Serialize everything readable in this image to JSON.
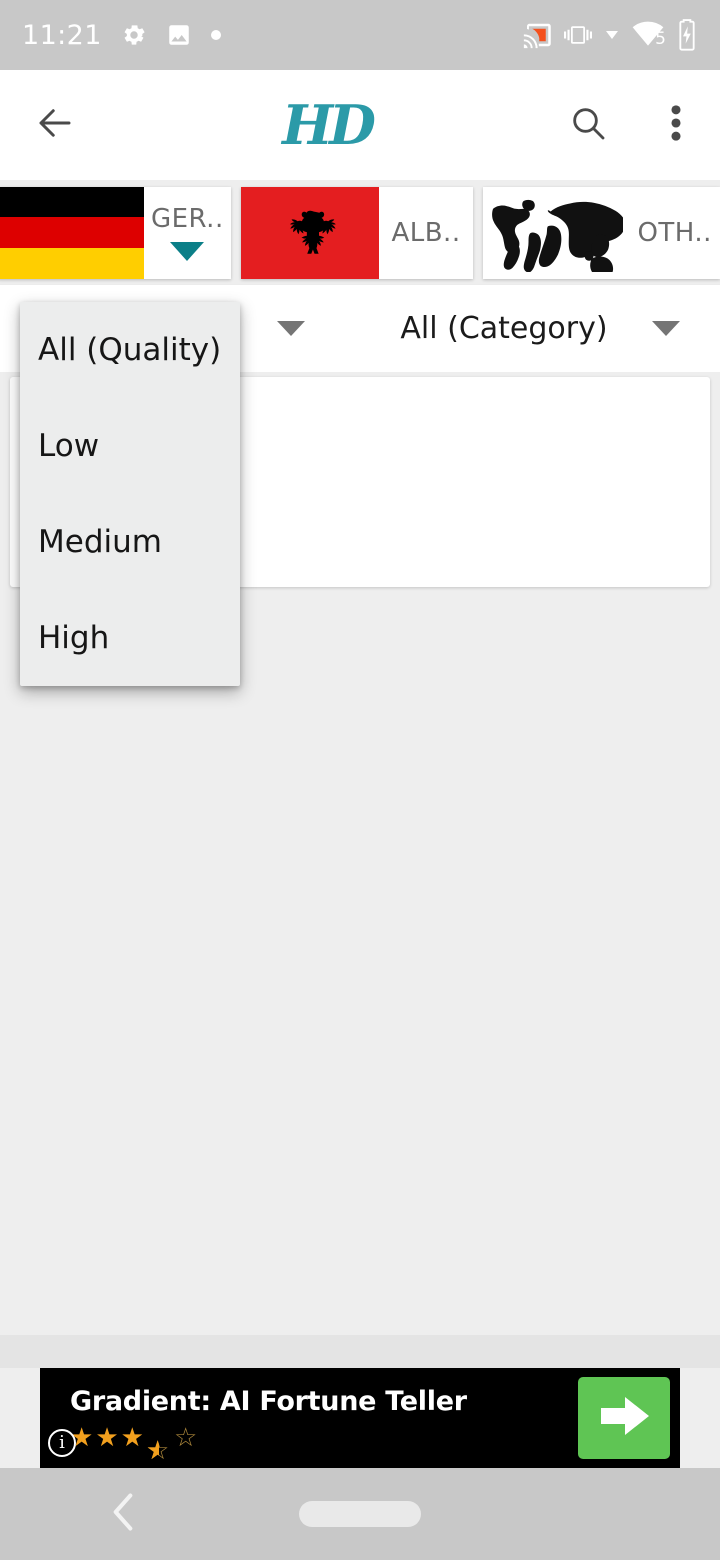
{
  "status_bar": {
    "time": "11:21",
    "left_icons": [
      "settings-gear-icon",
      "image-icon",
      "dot-icon"
    ],
    "right_icons": [
      "cast-icon",
      "vibrate-icon",
      "dropdown-arrow-icon",
      "wifi-icon",
      "battery-charging-icon"
    ],
    "wifi_badge": "5",
    "background": "#c8c8c8",
    "cast_color": "#f4511e"
  },
  "app_bar": {
    "back_icon": "back-arrow-icon",
    "logo_text": "HD",
    "logo_color": "#2b9aa8",
    "search_icon": "search-icon",
    "overflow_icon": "more-vertical-icon",
    "background": "#ffffff"
  },
  "country_tabs": [
    {
      "label": "GER..",
      "flag": "germany-flag",
      "selected": true,
      "indicator_color": "#0b7f88"
    },
    {
      "label": "ALB..",
      "flag": "albania-flag",
      "selected": false,
      "indicator_color": ""
    },
    {
      "label": "OTH..",
      "flag": "world-map-icon",
      "selected": false,
      "indicator_color": ""
    }
  ],
  "filters": {
    "quality": {
      "value": "All (Quality)",
      "caret": "chevron-down-icon",
      "expanded": true
    },
    "category": {
      "value": "All (Category)",
      "caret": "chevron-down-icon",
      "expanded": false
    }
  },
  "quality_dropdown": {
    "open": true,
    "background": "#eceded",
    "items": [
      {
        "label": "All (Quality)",
        "selected": true
      },
      {
        "label": "Low",
        "selected": false
      },
      {
        "label": "Medium",
        "selected": false
      },
      {
        "label": "High",
        "selected": false
      }
    ]
  },
  "content": {
    "background": "#eeeeee"
  },
  "ad": {
    "title": "Gradient: AI Fortune Teller",
    "rating": 3.5,
    "stars": [
      "full",
      "full",
      "full",
      "half",
      "empty"
    ],
    "info_glyph": "i",
    "cta_icon": "arrow-right-icon",
    "cta_color": "#5fc554",
    "background": "#000000"
  },
  "nav_bar": {
    "back_icon": "chevron-left-icon",
    "home_pill": "home-indicator",
    "background": "#c8c8c8"
  }
}
